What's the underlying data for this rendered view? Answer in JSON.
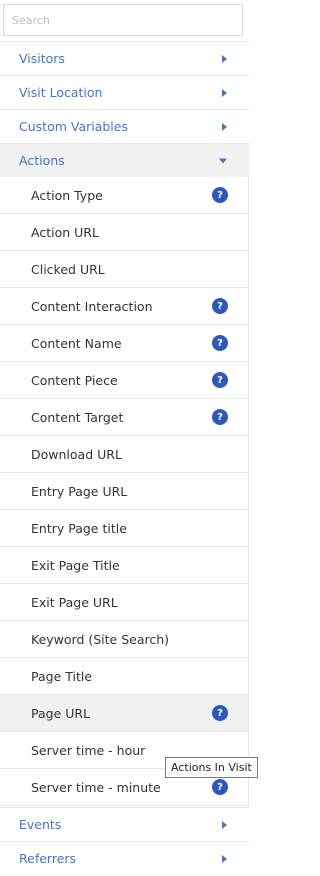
{
  "search": {
    "placeholder": "Search",
    "value": ""
  },
  "categories_top": [
    {
      "label": "Visitors",
      "icon": "arrow-right-icon"
    },
    {
      "label": "Visit Location",
      "icon": "arrow-right-icon"
    },
    {
      "label": "Custom Variables",
      "icon": "arrow-right-icon"
    },
    {
      "label": "Actions",
      "icon": "arrow-down-icon",
      "expanded": true
    }
  ],
  "actions_items": [
    {
      "label": "Action Type",
      "help": true
    },
    {
      "label": "Action URL",
      "help": false
    },
    {
      "label": "Clicked URL",
      "help": false
    },
    {
      "label": "Content Interaction",
      "help": true
    },
    {
      "label": "Content Name",
      "help": true
    },
    {
      "label": "Content Piece",
      "help": true
    },
    {
      "label": "Content Target",
      "help": true
    },
    {
      "label": "Download URL",
      "help": false
    },
    {
      "label": "Entry Page URL",
      "help": false
    },
    {
      "label": "Entry Page title",
      "help": false
    },
    {
      "label": "Exit Page Title",
      "help": false
    },
    {
      "label": "Exit Page URL",
      "help": false
    },
    {
      "label": "Keyword (Site Search)",
      "help": false
    },
    {
      "label": "Page Title",
      "help": false
    },
    {
      "label": "Page URL",
      "help": true,
      "hovered": true
    },
    {
      "label": "Server time - hour",
      "help": false
    },
    {
      "label": "Server time - minute",
      "help": true
    }
  ],
  "help_glyph": "?",
  "categories_bottom": [
    {
      "label": "Events",
      "icon": "arrow-right-icon"
    },
    {
      "label": "Referrers",
      "icon": "arrow-right-icon"
    }
  ],
  "tooltip": {
    "text": "Actions In Visit"
  },
  "colors": {
    "link": "#4a74b8",
    "help_badge": "#2e59b8",
    "hover_bg": "#f1f1f1"
  }
}
